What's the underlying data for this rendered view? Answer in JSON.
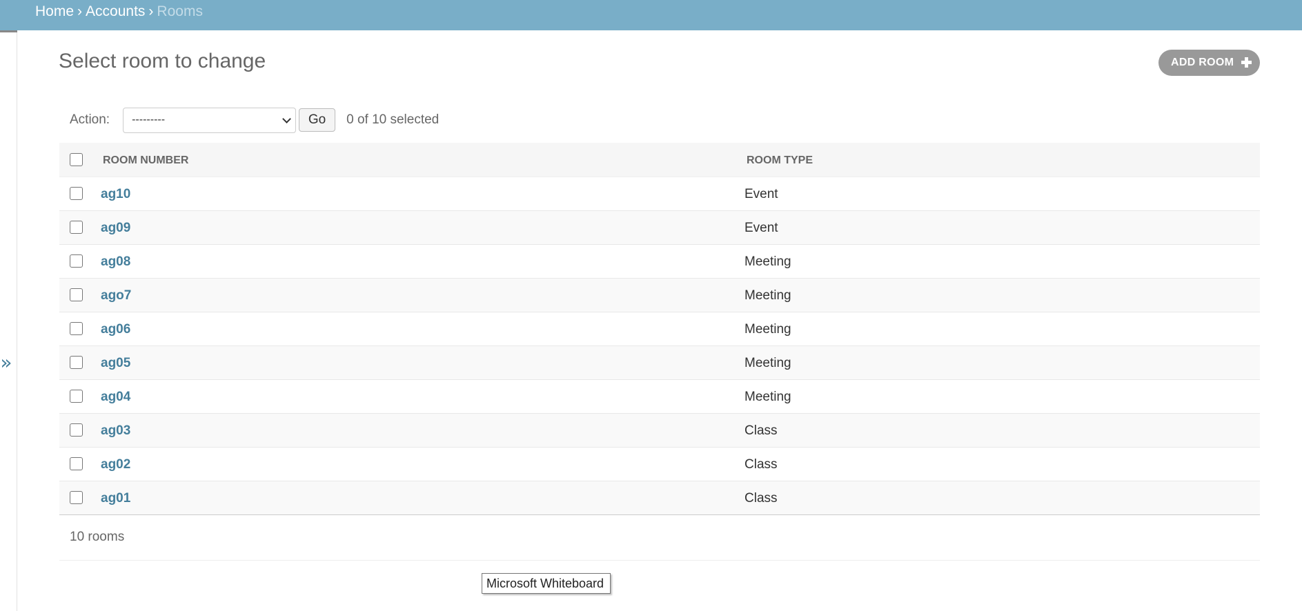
{
  "breadcrumbs": {
    "home": "Home",
    "accounts": "Accounts",
    "current": "Rooms",
    "separator": "›"
  },
  "sidebar": {
    "toggle_icon": "»"
  },
  "page": {
    "title": "Select room to change",
    "add_button": "ADD ROOM"
  },
  "actions": {
    "label": "Action:",
    "selected_value": "---------",
    "go_button": "Go",
    "selected_count": "0 of 10 selected"
  },
  "table": {
    "columns": [
      "ROOM NUMBER",
      "ROOM TYPE"
    ],
    "rows": [
      {
        "room_number": "ag10",
        "room_type": "Event"
      },
      {
        "room_number": "ag09",
        "room_type": "Event"
      },
      {
        "room_number": "ag08",
        "room_type": "Meeting"
      },
      {
        "room_number": "ago7",
        "room_type": "Meeting"
      },
      {
        "room_number": "ag06",
        "room_type": "Meeting"
      },
      {
        "room_number": "ag05",
        "room_type": "Meeting"
      },
      {
        "room_number": "ag04",
        "room_type": "Meeting"
      },
      {
        "room_number": "ag03",
        "room_type": "Class"
      },
      {
        "room_number": "ag02",
        "room_type": "Class"
      },
      {
        "room_number": "ag01",
        "room_type": "Class"
      }
    ]
  },
  "paginator": {
    "count": "10 rooms"
  },
  "tooltip": {
    "text": "Microsoft Whiteboard"
  },
  "colors": {
    "header_bar": "#79aec8",
    "link": "#447e9b",
    "add_button": "#999999"
  }
}
